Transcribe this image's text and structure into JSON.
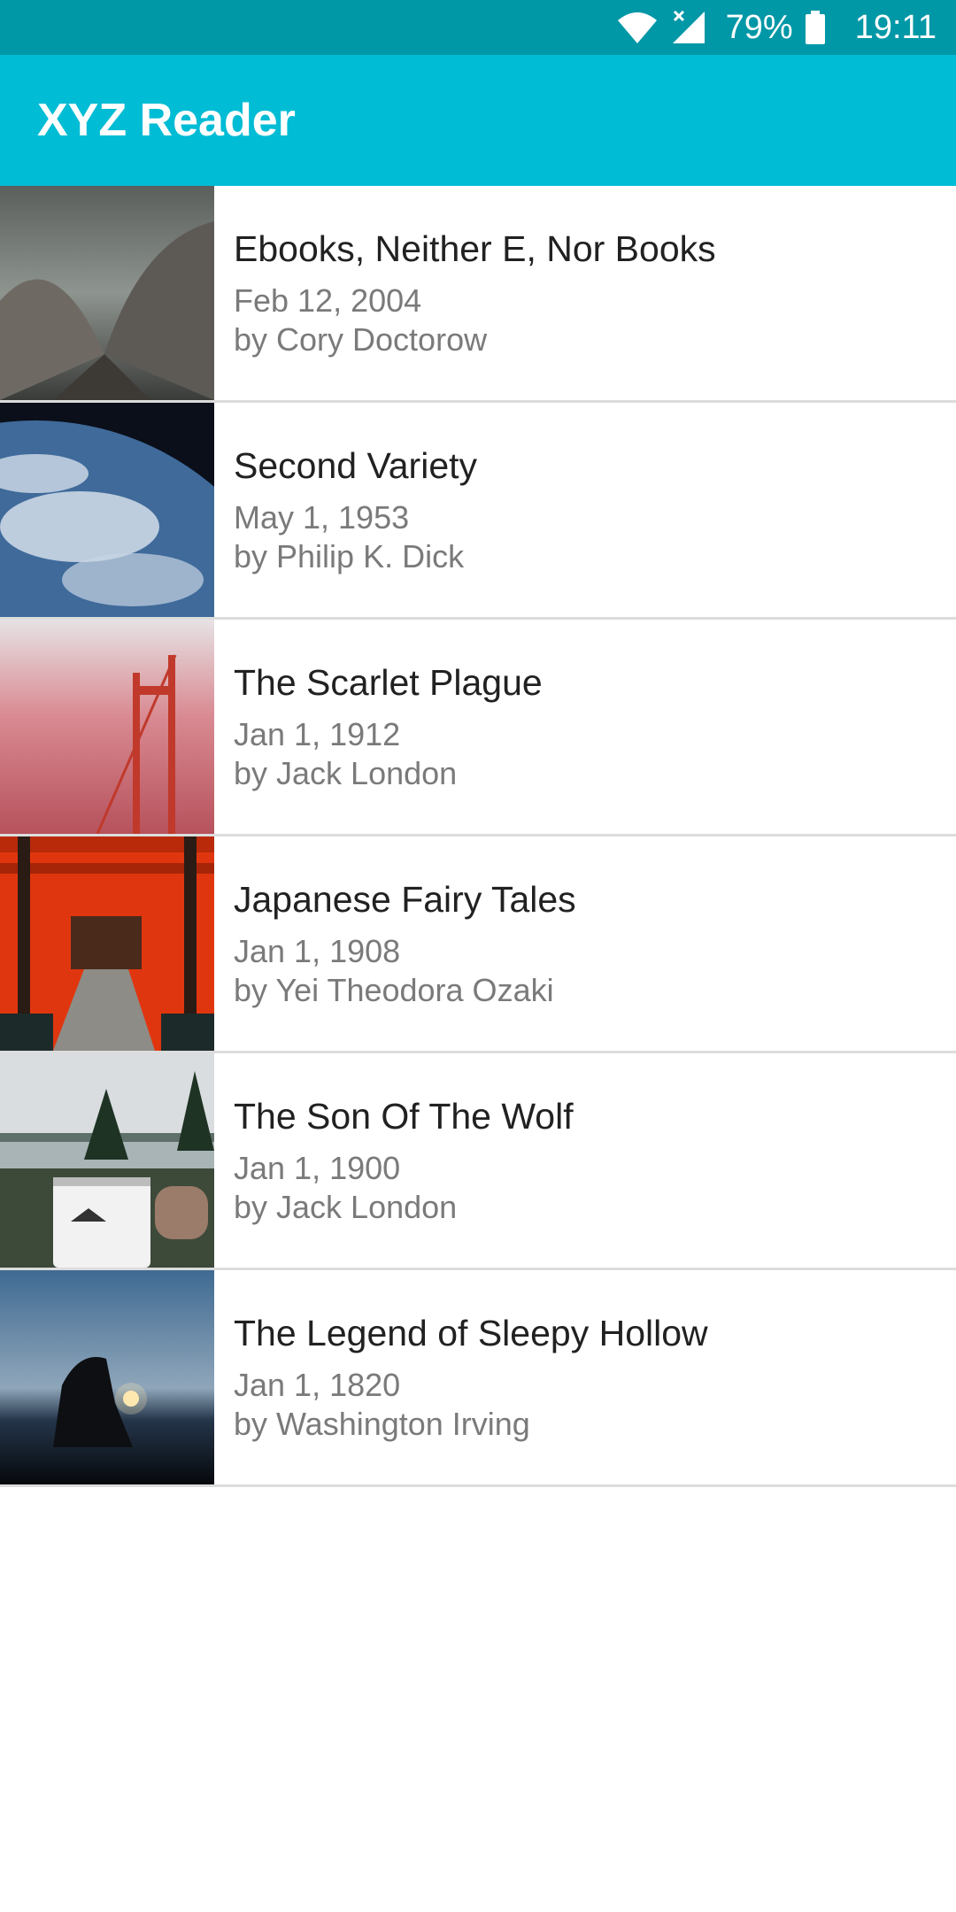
{
  "status_bar": {
    "battery": "79%",
    "time": "19:11",
    "icons": [
      "wifi-icon",
      "signal-icon",
      "battery-icon"
    ]
  },
  "app_bar": {
    "title": "XYZ Reader"
  },
  "books": [
    {
      "title": "Ebooks, Neither E, Nor Books",
      "date": "Feb 12, 2004",
      "author": "by Cory Doctorow"
    },
    {
      "title": "Second Variety",
      "date": "May 1, 1953",
      "author": "by Philip K. Dick"
    },
    {
      "title": "The Scarlet Plague",
      "date": "Jan 1, 1912",
      "author": "by Jack London"
    },
    {
      "title": "Japanese Fairy Tales",
      "date": "Jan 1, 1908",
      "author": "by Yei Theodora Ozaki"
    },
    {
      "title": "The Son Of The Wolf",
      "date": "Jan 1, 1900",
      "author": "by Jack London"
    },
    {
      "title": "The Legend of Sleepy Hollow",
      "date": "Jan 1, 1820",
      "author": "by Washington Irving"
    }
  ],
  "colors": {
    "status_bar": "#0097a7",
    "app_bar": "#00bcd4",
    "title_text": "#212121",
    "meta_text": "#7a7a7a",
    "divider": "#dcdcdc"
  }
}
